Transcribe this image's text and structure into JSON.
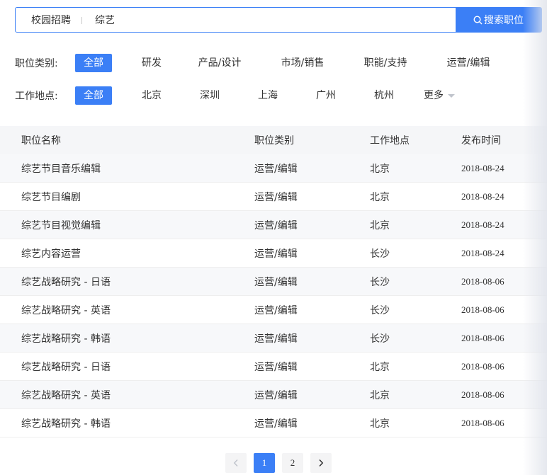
{
  "search": {
    "scope": "校园招聘",
    "query": "综艺",
    "button_label": "搜索职位"
  },
  "filters": {
    "category": {
      "label": "职位类别:",
      "options": [
        "全部",
        "研发",
        "产品/设计",
        "市场/销售",
        "职能/支持",
        "运营/编辑"
      ],
      "selected": "全部"
    },
    "location": {
      "label": "工作地点:",
      "options": [
        "全部",
        "北京",
        "深圳",
        "上海",
        "广州",
        "杭州"
      ],
      "more_label": "更多",
      "selected": "全部"
    }
  },
  "table": {
    "headers": [
      "职位名称",
      "职位类别",
      "工作地点",
      "发布时间"
    ],
    "rows": [
      [
        "综艺节目音乐编辑",
        "运营/编辑",
        "北京",
        "2018-08-24"
      ],
      [
        "综艺节目编剧",
        "运营/编辑",
        "北京",
        "2018-08-24"
      ],
      [
        "综艺节目视觉编辑",
        "运营/编辑",
        "北京",
        "2018-08-24"
      ],
      [
        "综艺内容运营",
        "运营/编辑",
        "长沙",
        "2018-08-24"
      ],
      [
        "综艺战略研究 - 日语",
        "运营/编辑",
        "长沙",
        "2018-08-06"
      ],
      [
        "综艺战略研究 - 英语",
        "运营/编辑",
        "长沙",
        "2018-08-06"
      ],
      [
        "综艺战略研究 - 韩语",
        "运营/编辑",
        "长沙",
        "2018-08-06"
      ],
      [
        "综艺战略研究 - 日语",
        "运营/编辑",
        "北京",
        "2018-08-06"
      ],
      [
        "综艺战略研究 - 英语",
        "运营/编辑",
        "北京",
        "2018-08-06"
      ],
      [
        "综艺战略研究 - 韩语",
        "运营/编辑",
        "北京",
        "2018-08-06"
      ]
    ]
  },
  "pagination": {
    "prev": "<",
    "pages": [
      "1",
      "2"
    ],
    "current": "1",
    "next": ">"
  },
  "colors": {
    "accent": "#3b7ff6",
    "row_alt": "#f7f8fa",
    "header_bg": "#f5f6f8"
  }
}
